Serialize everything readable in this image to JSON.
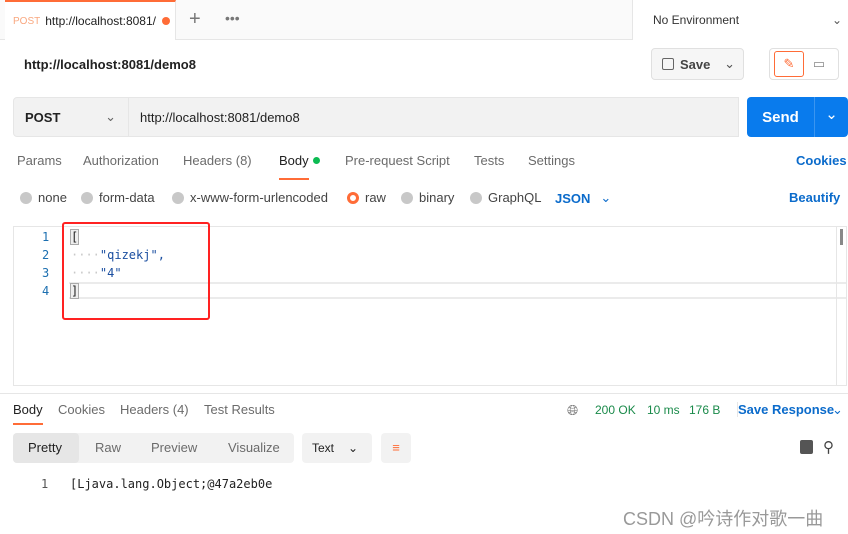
{
  "tab": {
    "method": "POST",
    "title": "http://localhost:8081/",
    "unsaved_color": "#ff6c37"
  },
  "environment": "No Environment",
  "request_name": "http://localhost:8081/demo8",
  "save_label": "Save",
  "method": "POST",
  "url": "http://localhost:8081/demo8",
  "send_label": "Send",
  "request_tabs": [
    "Params",
    "Authorization",
    "Headers (8)",
    "Body",
    "Pre-request Script",
    "Tests",
    "Settings"
  ],
  "active_request_tab": "Body",
  "cookies_label": "Cookies",
  "body_types": [
    "none",
    "form-data",
    "x-www-form-urlencoded",
    "raw",
    "binary",
    "GraphQL"
  ],
  "selected_body_type": "raw",
  "format": "JSON",
  "beautify_label": "Beautify",
  "code_lines": [
    {
      "n": "1",
      "text": "["
    },
    {
      "n": "2",
      "text": "\"qizekj\","
    },
    {
      "n": "3",
      "text": "\"4\""
    },
    {
      "n": "4",
      "text": "]"
    }
  ],
  "response_tabs": [
    "Body",
    "Cookies",
    "Headers (4)",
    "Test Results"
  ],
  "status": "200 OK",
  "time": "10 ms",
  "size": "176 B",
  "save_response_label": "Save Response",
  "view_modes": [
    "Pretty",
    "Raw",
    "Preview",
    "Visualize"
  ],
  "response_format": "Text",
  "response_lines": [
    {
      "n": "1",
      "text": "[Ljava.lang.Object;@47a2eb0e"
    }
  ],
  "watermark": "CSDN @吟诗作对歌一曲"
}
